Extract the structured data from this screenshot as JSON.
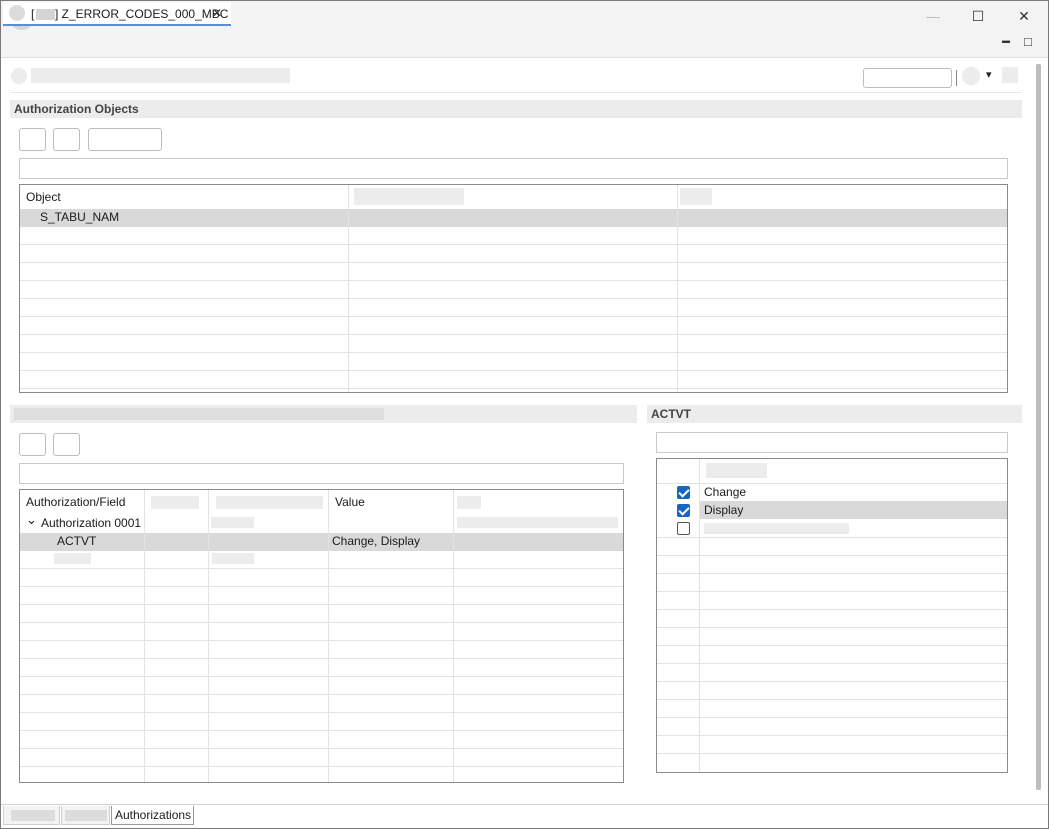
{
  "window": {
    "controls": {
      "minimize": "—",
      "maximize": "☐",
      "close": "✕"
    }
  },
  "editor_tab": {
    "prefix": "[",
    "title": "] Z_ERROR_CODES_000_MBC",
    "close": "✕"
  },
  "view_controls": {
    "minimize": "▬",
    "maximize": "□"
  },
  "toolbar": {
    "dropdown_arrow": "▾"
  },
  "auth_objects": {
    "header": "Authorization Objects",
    "table": {
      "columns": [
        "Object"
      ],
      "rows": [
        {
          "object": "S_TABU_NAM"
        }
      ]
    }
  },
  "auth_fields": {
    "table": {
      "columns": {
        "field": "Authorization/Field",
        "value": "Value"
      },
      "group": {
        "expand_icon": "⌄",
        "label": "Authorization 0001"
      },
      "rows": [
        {
          "field": "ACTVT",
          "value": "Change, Display"
        }
      ]
    }
  },
  "actvt": {
    "header": "ACTVT",
    "items": [
      {
        "label": "Change",
        "checked": true
      },
      {
        "label": "Display",
        "checked": true
      }
    ]
  },
  "bottom_tabs": {
    "active": "Authorizations"
  },
  "colors": {
    "accent": "#1666c2",
    "tab_underline": "#5a8fd6",
    "selection": "#d9d9d9",
    "header_bg": "#ececec"
  }
}
